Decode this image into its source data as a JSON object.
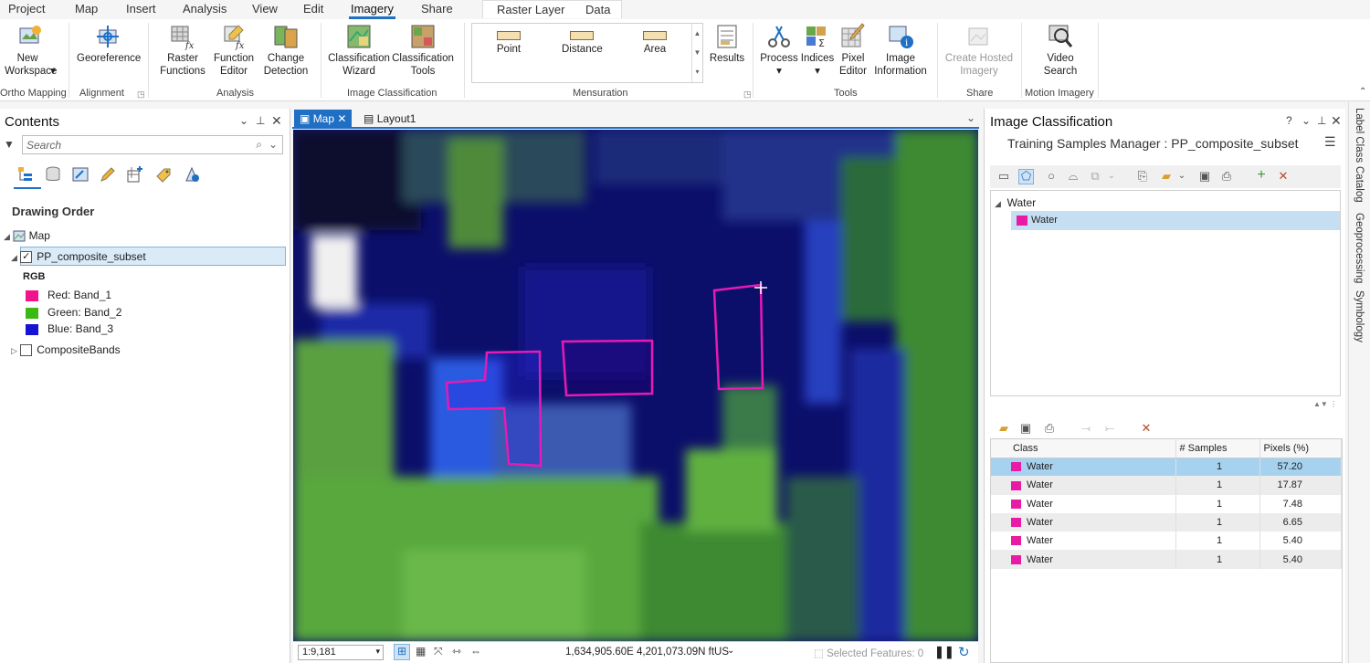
{
  "tabs": {
    "main": [
      "Project",
      "Map",
      "Insert",
      "Analysis",
      "View",
      "Edit",
      "Imagery",
      "Share"
    ],
    "active": "Imagery",
    "context": [
      "Raster Layer",
      "Data"
    ]
  },
  "ribbon": {
    "new_workspace": "New Workspace",
    "georeference": "Georeference",
    "raster_functions": "Raster Functions",
    "function_editor": "Function Editor",
    "change_detection": "Change Detection",
    "classification_wizard": "Classification Wizard",
    "classification_tools": "Classification Tools",
    "point": "Point",
    "distance": "Distance",
    "area": "Area",
    "results": "Results",
    "process": "Process",
    "indices": "Indices",
    "pixel_editor": "Pixel Editor",
    "image_information": "Image Information",
    "create_hosted_imagery": "Create Hosted Imagery",
    "video_search": "Video Search",
    "groups": {
      "ortho": "Ortho Mapping",
      "alignment": "Alignment",
      "analysis": "Analysis",
      "image_classification": "Image Classification",
      "mensuration": "Mensuration",
      "tools": "Tools",
      "share": "Share",
      "motion": "Motion Imagery"
    }
  },
  "contents": {
    "title": "Contents",
    "search_placeholder": "Search",
    "drawing_order": "Drawing Order",
    "map": "Map",
    "layer": "PP_composite_subset",
    "rgb": "RGB",
    "bands": [
      {
        "label": "Red:  Band_1",
        "color": "#f0148c"
      },
      {
        "label": "Green: Band_2",
        "color": "#3cb814"
      },
      {
        "label": "Blue:  Band_3",
        "color": "#1414d2"
      }
    ],
    "composite": "CompositeBands"
  },
  "views": {
    "map": "Map",
    "layout": "Layout1"
  },
  "status": {
    "scale": "1:9,181",
    "coords": "1,634,905.60E 4,201,073.09N ftUS",
    "selected": "Selected Features: 0"
  },
  "image_classification": {
    "title": "Image Classification",
    "help": "?",
    "subtitle": "Training Samples Manager : PP_composite_subset",
    "tree_parent": "Water",
    "tree_child": "Water",
    "class_color": "#e91aa6",
    "table": {
      "headers": [
        "Class",
        "# Samples",
        "Pixels (%)"
      ],
      "rows": [
        {
          "cls": "Water",
          "samples": "1",
          "pixels": "57.20"
        },
        {
          "cls": "Water",
          "samples": "1",
          "pixels": "17.87"
        },
        {
          "cls": "Water",
          "samples": "1",
          "pixels": "7.48"
        },
        {
          "cls": "Water",
          "samples": "1",
          "pixels": "6.65"
        },
        {
          "cls": "Water",
          "samples": "1",
          "pixels": "5.40"
        },
        {
          "cls": "Water",
          "samples": "1",
          "pixels": "5.40"
        }
      ]
    }
  },
  "side_tabs": [
    "Label Class",
    "Catalog",
    "Geoprocessing",
    "Symbology"
  ],
  "colors": {
    "accent": "#1f6fc5",
    "sample_outline": "#e61ab4",
    "selected_row": "#a6d2ef"
  }
}
